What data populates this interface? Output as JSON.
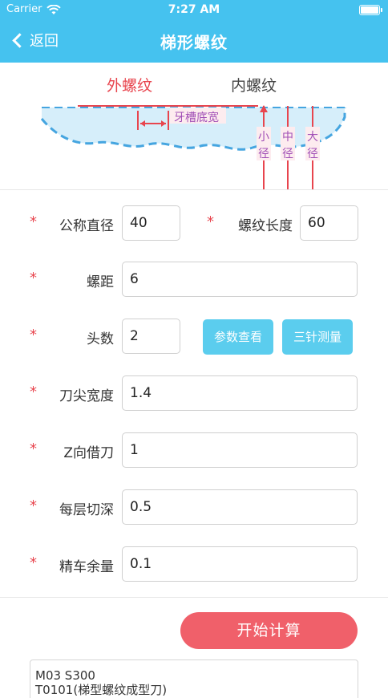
{
  "status_bar": {
    "carrier": "Carrier",
    "time": "7:27 AM"
  },
  "nav": {
    "back_label": "返回",
    "title": "梯形螺纹"
  },
  "tabs": {
    "external": "外螺纹",
    "internal": "内螺纹",
    "selected": "external"
  },
  "diagram": {
    "groove_width_label": "牙槽底宽",
    "minor_diameter_label": [
      "小",
      "径"
    ],
    "pitch_diameter_label": [
      "中",
      "径"
    ],
    "major_diameter_label": [
      "大",
      "径"
    ]
  },
  "form": {
    "nominal_diameter": {
      "label": "公称直径",
      "value": "40"
    },
    "thread_length": {
      "label": "螺纹长度",
      "value": "60"
    },
    "pitch": {
      "label": "螺距",
      "value": "6"
    },
    "starts": {
      "label": "头数",
      "value": "2"
    },
    "tip_width": {
      "label": "刀尖宽度",
      "value": "1.4"
    },
    "z_offset": {
      "label": "Z向借刀",
      "value": "1"
    },
    "depth_per_layer": {
      "label": "每层切深",
      "value": "0.5"
    },
    "finish_allowance": {
      "label": "精车余量",
      "value": "0.1"
    },
    "required_mark": "*"
  },
  "buttons": {
    "params": "参数查看",
    "three_wire": "三针测量",
    "calculate": "开始计算"
  },
  "output": {
    "lines": [
      "M03 S300",
      "T0101(梯型螺纹成型刀)"
    ]
  },
  "colors": {
    "header": "#45c2ef",
    "accent_red": "#e8454e",
    "button_cyan": "#5bcdee",
    "calc_red": "#f0606a"
  }
}
